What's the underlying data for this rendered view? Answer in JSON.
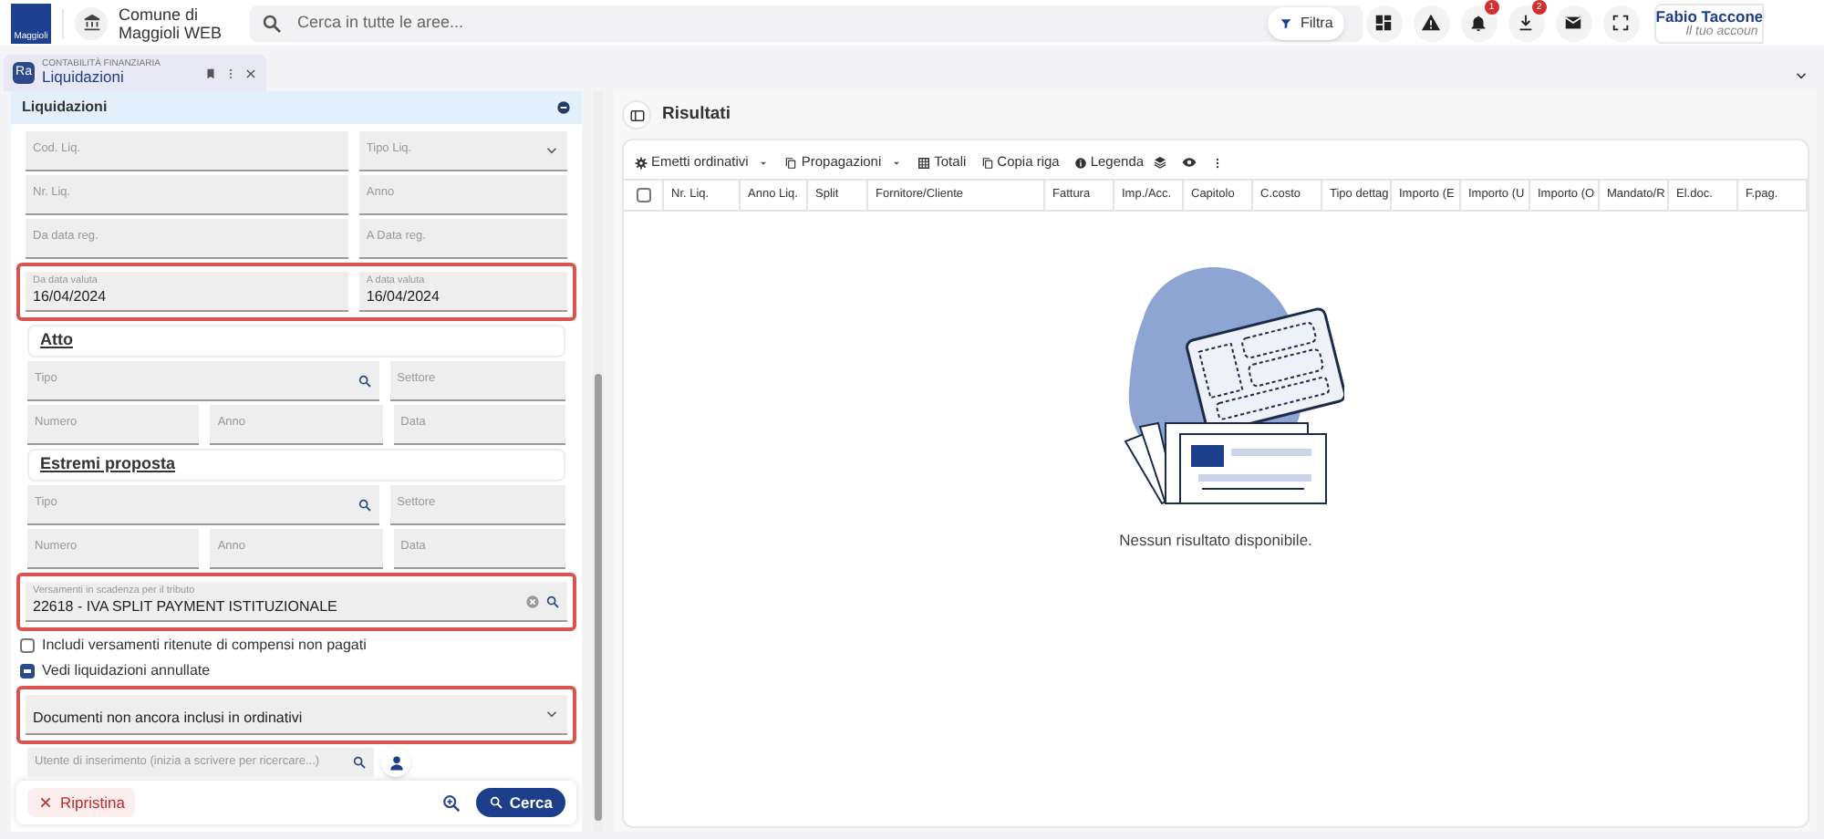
{
  "topbar": {
    "logo": "Maggioli",
    "app_name": "Comune di Maggioli WEB",
    "search": {
      "placeholder": "Cerca in tutte le aree..."
    },
    "filter": "Filtra",
    "badges": [
      {
        "count": "1"
      },
      {
        "count": "2"
      }
    ],
    "user": {
      "name": "Fabio Taccone",
      "subtitle": "Il tuo accoun"
    }
  },
  "tab": {
    "badge": "Ra",
    "module": "CONTABILITÀ FINANZIARIA",
    "title": "Liquidazioni",
    "selected": true
  },
  "filters": {
    "title": "Liquidazioni",
    "items": [
      {
        "kind": "fields",
        "highlighted": false,
        "fields": [
          {
            "kind": "text",
            "label": "Cod. Liq."
          },
          {
            "kind": "select",
            "label": "Tipo Liq."
          }
        ]
      },
      {
        "kind": "fields",
        "highlighted": false,
        "fields": [
          {
            "kind": "text",
            "label": "Nr. Liq."
          },
          {
            "kind": "text",
            "label": "Anno"
          }
        ]
      },
      {
        "kind": "fields",
        "highlighted": false,
        "fields": [
          {
            "kind": "text",
            "label": "Da data reg."
          },
          {
            "kind": "text",
            "label": "A Data reg."
          }
        ]
      },
      {
        "kind": "fields",
        "highlighted": true,
        "fields": [
          {
            "kind": "text",
            "label": "Da data valuta",
            "value": "16/04/2024"
          },
          {
            "kind": "text",
            "label": "A data valuta",
            "value": "16/04/2024"
          }
        ]
      },
      {
        "kind": "section",
        "title": "Atto"
      },
      {
        "kind": "fields",
        "highlighted": false,
        "fields": [
          {
            "kind": "search",
            "label": "Tipo"
          },
          {
            "kind": "text",
            "label": "Settore"
          }
        ]
      },
      {
        "kind": "fields",
        "highlighted": false,
        "fields": [
          {
            "kind": "text",
            "label": "Numero"
          },
          {
            "kind": "text",
            "label": "Anno"
          },
          {
            "kind": "text",
            "label": "Data"
          }
        ]
      },
      {
        "kind": "section",
        "title": "Estremi proposta"
      },
      {
        "kind": "fields",
        "highlighted": false,
        "fields": [
          {
            "kind": "search",
            "label": "Tipo"
          },
          {
            "kind": "text",
            "label": "Settore"
          }
        ]
      },
      {
        "kind": "fields",
        "highlighted": false,
        "fields": [
          {
            "kind": "text",
            "label": "Numero"
          },
          {
            "kind": "text",
            "label": "Anno"
          },
          {
            "kind": "text",
            "label": "Data"
          }
        ]
      },
      {
        "kind": "fields",
        "highlighted": true,
        "fields": [
          {
            "kind": "clearsearch",
            "label": "Versamenti in scadenza per il tributo",
            "value": "22618 - IVA SPLIT PAYMENT ISTITUZIONALE"
          }
        ]
      },
      {
        "kind": "checkbox",
        "label": "Includi versamenti ritenute di compensi non pagati",
        "checked": false
      },
      {
        "kind": "checkbox",
        "label": "Vedi liquidazioni annullate",
        "checked": true
      },
      {
        "kind": "fields",
        "highlighted": true,
        "fields": [
          {
            "kind": "select",
            "value": "Documenti non ancora inclusi in ordinativi"
          }
        ]
      },
      {
        "kind": "user",
        "label": "Utente di inserimento (inizia a scrivere per ricercare...)"
      }
    ],
    "reset": "Ripristina",
    "search": "Cerca"
  },
  "results": {
    "title": "Risultati",
    "toolbar": [
      {
        "label": "Emetti ordinativi",
        "menu": true
      },
      {
        "label": "Propagazioni",
        "menu": true
      },
      {
        "label": "Totali",
        "menu": false
      },
      {
        "label": "Copia riga",
        "menu": false
      },
      {
        "label": "Legenda",
        "menu": false
      }
    ],
    "select_all": {
      "checked": false
    },
    "columns": [
      "Nr. Liq.",
      "Anno Liq.",
      "Split",
      "Fornitore/Cliente",
      "Fattura",
      "Imp./Acc.",
      "Capitolo",
      "C.costo",
      "Tipo dettag",
      "Importo (E",
      "Importo (U",
      "Importo (O",
      "Mandato/R",
      "El.doc.",
      "F.pag."
    ],
    "empty_message": "Nessun risultato disponibile."
  }
}
